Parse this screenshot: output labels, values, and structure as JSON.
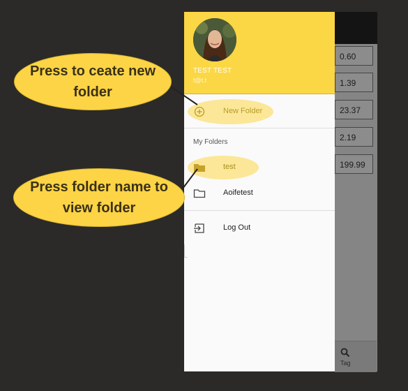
{
  "annotations": {
    "new_folder_hint": "Press to ceate new folder",
    "view_folder_hint": "Press folder name to view folder"
  },
  "drawer": {
    "user_name": "TEST TEST",
    "user_email": "t@t.t",
    "new_folder_label": "New Folder",
    "section_title": "My Folders",
    "folders": [
      "test",
      "Aoifetest"
    ],
    "logout_label": "Log Out"
  },
  "background_app": {
    "prices": [
      "0.60",
      "1.39",
      "23.37",
      "2.19",
      "199.99"
    ],
    "tab_label": "Tag"
  },
  "colors": {
    "accent_yellow": "#fcd745",
    "page_bg": "#2b2a29",
    "folder_icon_gold": "#c7a22a"
  },
  "icons": {
    "new_folder": "plus-circle-icon",
    "folder_filled": "folder-filled-icon",
    "folder_outline": "folder-outline-icon",
    "logout": "logout-icon",
    "search": "search-icon"
  }
}
